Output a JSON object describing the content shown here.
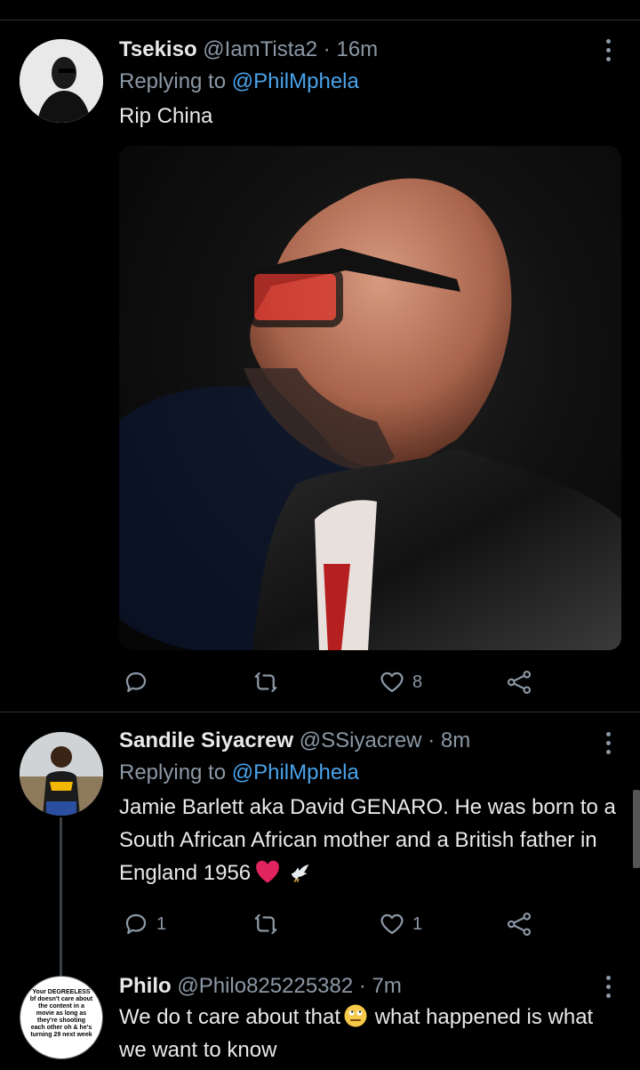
{
  "tweets": [
    {
      "name": "Tsekiso",
      "handle": "@IamTista2",
      "time": "16m",
      "reply_prefix": "Replying to",
      "reply_to": "@PhilMphela",
      "text": "Rip China",
      "likes": "8"
    },
    {
      "name": "Sandile Siyacrew",
      "handle": "@SSiyacrew",
      "time": "8m",
      "reply_prefix": "Replying to",
      "reply_to": "@PhilMphela",
      "text": "Jamie Barlett aka David GENARO. He was born to a South African African mother and a British father in England 1956",
      "replies": "1",
      "likes": "1"
    },
    {
      "name": "Philo",
      "handle": "@Philo825225382",
      "time": "7m",
      "text_a": "We do t care about that",
      "text_b": " what happened is what we want to know",
      "avatar_caption": "Your DEGREELESS bf doesn't care about the content in a movie as long as they're shooting each other oh & he's turning 29 next week"
    }
  ],
  "separator": "·",
  "colors": {
    "background": "#000000",
    "text": "#e7e9ea",
    "muted": "#8b98a5",
    "link": "#4aa3ea",
    "heart": "#e0245e"
  }
}
